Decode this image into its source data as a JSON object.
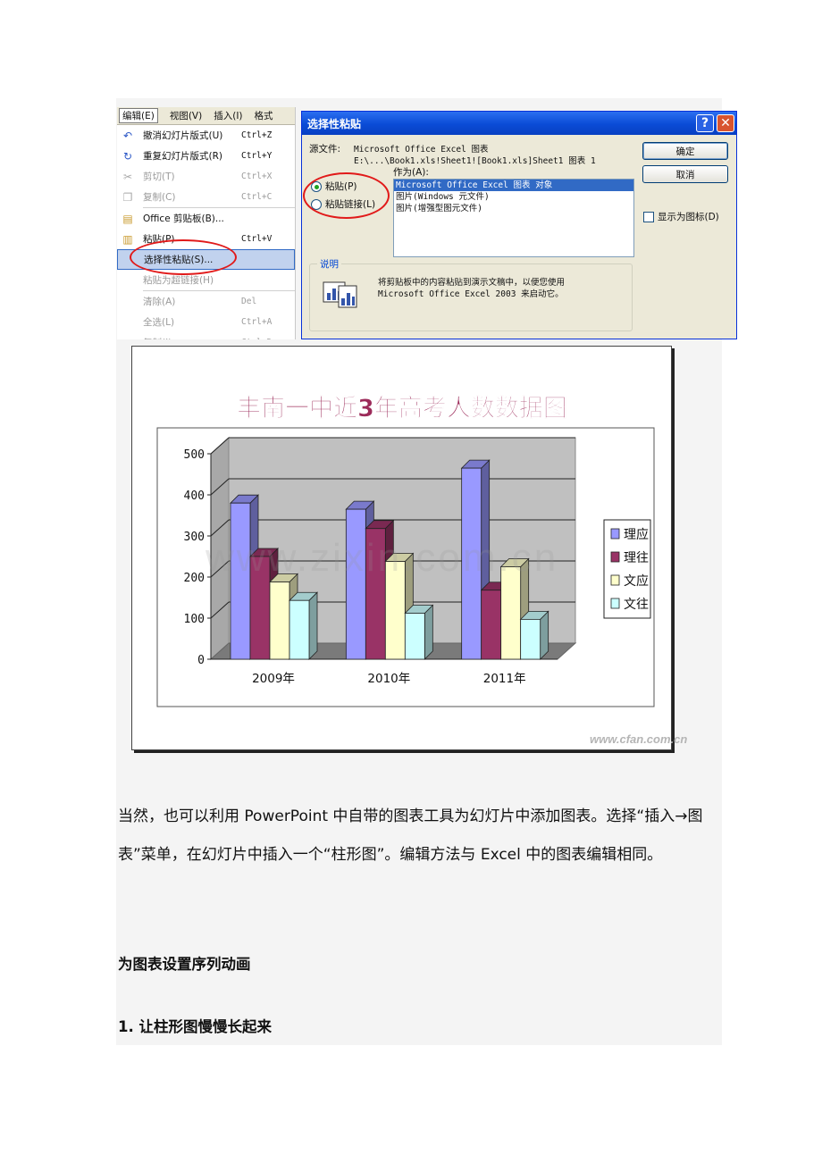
{
  "menu": {
    "bar": [
      "编辑(E)",
      "视图(V)",
      "插入(I)",
      "格式"
    ],
    "items": [
      {
        "label": "撤消幻灯片版式(U)",
        "shortcut": "Ctrl+Z",
        "icon": "undo-icon",
        "disabled": false
      },
      {
        "label": "重复幻灯片版式(R)",
        "shortcut": "Ctrl+Y",
        "icon": "redo-icon",
        "disabled": false
      },
      {
        "label": "剪切(T)",
        "shortcut": "Ctrl+X",
        "icon": "scissors-icon",
        "disabled": true
      },
      {
        "label": "复制(C)",
        "shortcut": "Ctrl+C",
        "icon": "copy-icon",
        "disabled": true
      },
      {
        "label": "Office 剪贴板(B)...",
        "shortcut": "",
        "icon": "clipboard-icon",
        "disabled": false
      },
      {
        "label": "粘贴(P)",
        "shortcut": "Ctrl+V",
        "icon": "paste-icon",
        "disabled": false
      },
      {
        "label": "选择性粘贴(S)...",
        "shortcut": "",
        "icon": "",
        "disabled": false,
        "highlighted": true
      },
      {
        "label": "粘贴为超链接(H)",
        "shortcut": "",
        "icon": "",
        "disabled": true
      },
      {
        "label": "清除(A)",
        "shortcut": "Del",
        "icon": "",
        "disabled": true
      },
      {
        "label": "全选(L)",
        "shortcut": "Ctrl+A",
        "icon": "",
        "disabled": true
      },
      {
        "label": "复制(I)",
        "shortcut": "Ctrl+D",
        "icon": "",
        "disabled": true
      }
    ]
  },
  "dialog": {
    "title": "选择性粘贴",
    "source_label": "源文件:",
    "source_line1": "Microsoft Office Excel 图表",
    "source_line2": "E:\\...\\Book1.xls!Sheet1![Book1.xls]Sheet1 图表 1",
    "as_label": "作为(A):",
    "radio_paste": "粘贴(P)",
    "radio_paste_link": "粘贴链接(L)",
    "list_items": [
      "Microsoft Office Excel 图表 对象",
      "图片(Windows 元文件)",
      "图片(增强型图元文件)"
    ],
    "ok": "确定",
    "cancel": "取消",
    "show_as_icon": "显示为图标(D)",
    "desc_label": "说明",
    "desc_line1": "将剪贴板中的内容粘贴到演示文稿中，以便您使用",
    "desc_line2": "Microsoft Office Excel 2003 来启动它。"
  },
  "chart_data": {
    "type": "bar",
    "title": "丰南一中近3年高考人数数据图",
    "categories": [
      "2009年",
      "2010年",
      "2011年"
    ],
    "series": [
      {
        "name": "理应",
        "values": [
          380,
          365,
          465
        ],
        "color": "#9999ff"
      },
      {
        "name": "理往",
        "values": [
          250,
          318,
          168
        ],
        "color": "#993366"
      },
      {
        "name": "文应",
        "values": [
          188,
          238,
          225
        ],
        "color": "#ffffcc"
      },
      {
        "name": "文往",
        "values": [
          143,
          112,
          97
        ],
        "color": "#ccffff"
      }
    ],
    "ylim": [
      0,
      500
    ],
    "yticks": [
      "0",
      "100",
      "200",
      "300",
      "400",
      "500"
    ],
    "legend": "right",
    "grid": true
  },
  "watermarks": {
    "center": "www.zixin.com.cn",
    "corner": "www.cfan.com.cn"
  },
  "text": {
    "paragraph": "当然，也可以利用 PowerPoint 中自带的图表工具为幻灯片中添加图表。选择“插入→图表”菜单，在幻灯片中插入一个“柱形图”。编辑方法与 Excel 中的图表编辑相同。",
    "heading1": "为图表设置序列动画",
    "heading2": "1. 让柱形图慢慢长起来"
  }
}
